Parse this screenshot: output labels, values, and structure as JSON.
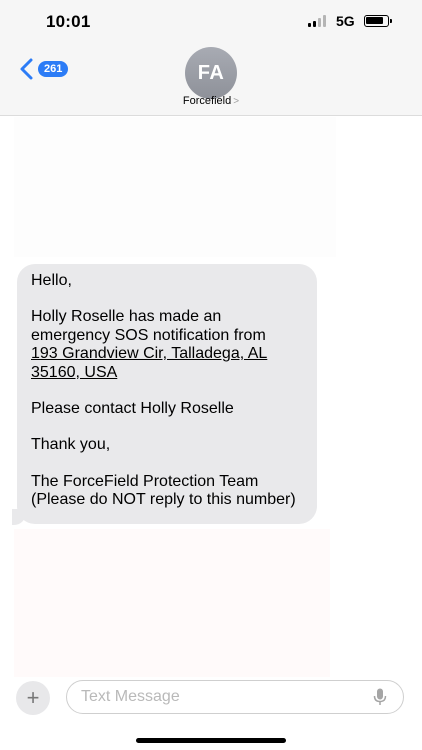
{
  "status_bar": {
    "time": "10:01",
    "network": "5G"
  },
  "header": {
    "back_badge": "261",
    "avatar_initials": "FA",
    "contact_name": "Forcefield",
    "contact_chevron": ">"
  },
  "message": {
    "greeting": "Hello,",
    "notice": "Holly Roselle has made an emergency SOS notification from",
    "address": "193 Grandview Cir, Talladega, AL 35160, USA",
    "request": "Please contact Holly Roselle",
    "thanks": "Thank you,",
    "signature": "The ForceField Protection Team",
    "disclaimer": "(Please do NOT reply to this number)"
  },
  "input": {
    "placeholder": "Text Message",
    "plus_label": "+"
  },
  "colors": {
    "accent": "#2c7cf6",
    "bubble": "#e9e9eb",
    "header_bg": "#f6f6f6"
  }
}
